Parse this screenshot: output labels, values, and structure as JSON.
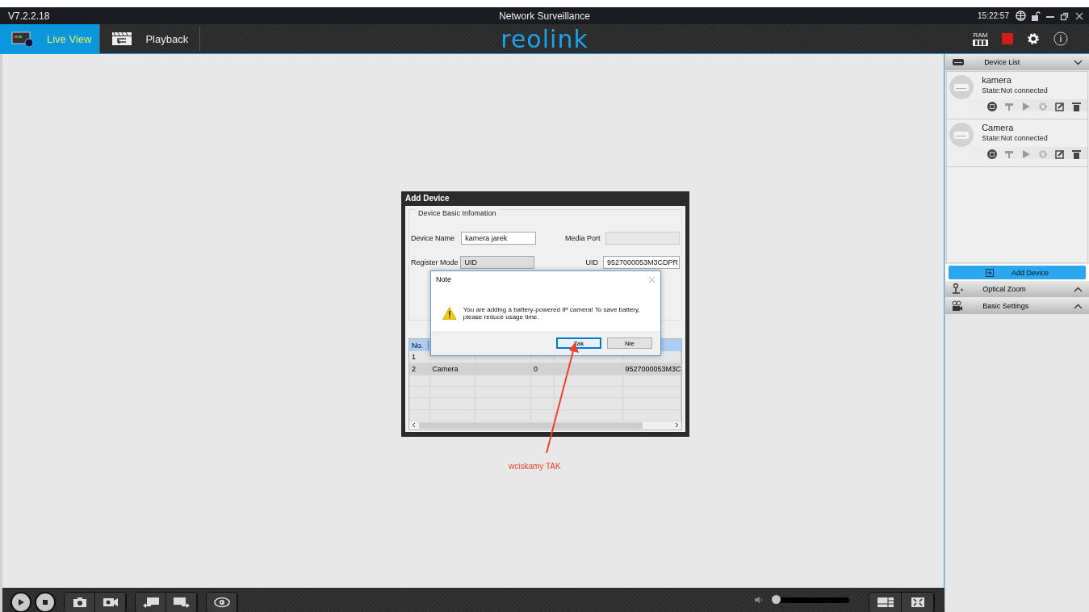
{
  "title_bar": {
    "version": "V7.2.2.18",
    "title": "Network Surveillance",
    "time": "15:22:57"
  },
  "toolbar": {
    "tabs": [
      {
        "label": "Live View",
        "kind": "live",
        "selected": true
      },
      {
        "label": "Playback",
        "kind": "playback",
        "selected": false
      }
    ],
    "logo": "reolink",
    "ram_label": "RAM"
  },
  "device_list": {
    "title": "Device List",
    "expanded": true,
    "devices": [
      {
        "name": "kamera",
        "state": "State:Not connected"
      },
      {
        "name": "Camera",
        "state": "State:Not connected"
      }
    ]
  },
  "add_device_button": "Add Device",
  "panels": [
    {
      "title": "Optical Zoom",
      "kind": "zoom",
      "expanded": false
    },
    {
      "title": "Basic Settings",
      "kind": "settings",
      "expanded": false
    }
  ],
  "add_device_dialog": {
    "title": "Add Device",
    "section": "Device Basic Infomation",
    "device_name_label": "Device Name",
    "device_name": "kamera jarek",
    "media_port_label": "Media Port",
    "register_mode_label": "Register Mode",
    "register_mode": "UID",
    "uid_label": "UID",
    "uid": "9527000053M3CDPR",
    "table": {
      "header": "No.",
      "rows": [
        {
          "column_1": "1"
        },
        {
          "column_1": "2",
          "column_2": "Camera",
          "column_4": "0",
          "column_6": "9527000053M3C"
        }
      ]
    }
  },
  "note_dialog": {
    "title": "Note",
    "message": "You are adding a battery-powered IP camera! To save battery, please reduce usage time.",
    "buttons": [
      {
        "label": "Tak",
        "selected": true
      },
      {
        "label": "Nie",
        "selected": false
      }
    ]
  },
  "annotation": {
    "text": "wciskamy TAK"
  },
  "bottom_bar": {
    "volume": {
      "level": 0
    }
  }
}
